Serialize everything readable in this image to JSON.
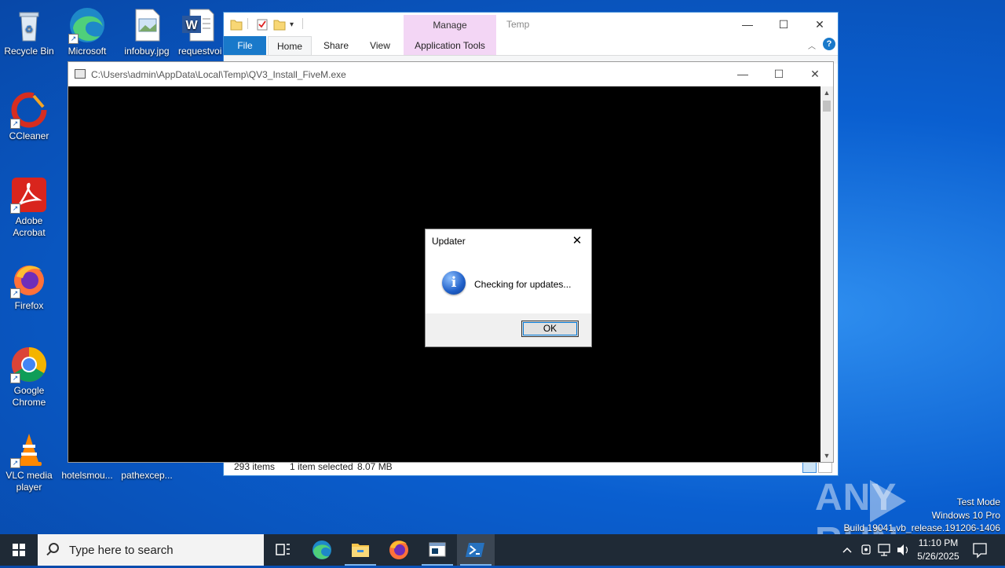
{
  "desktop": {
    "icons": [
      {
        "label": "Recycle Bin",
        "icon": "recycle-bin-icon"
      },
      {
        "label": "Microsoft",
        "icon": "edge-icon"
      },
      {
        "label": "infobuy.jpg",
        "icon": "image-file-icon"
      },
      {
        "label": "requestvoi",
        "icon": "word-doc-icon"
      },
      {
        "label": "CCleaner",
        "icon": "ccleaner-icon"
      },
      {
        "label": "Adobe Acrobat",
        "icon": "acrobat-icon"
      },
      {
        "label": "Firefox",
        "icon": "firefox-icon"
      },
      {
        "label": "Google Chrome",
        "icon": "chrome-icon"
      },
      {
        "label": "VLC media player",
        "icon": "vlc-icon"
      },
      {
        "label": "hotelsmou...",
        "icon": "file-icon"
      },
      {
        "label": "pathexcep...",
        "icon": "file-icon"
      }
    ]
  },
  "explorer": {
    "title": "Temp",
    "manage_label": "Manage",
    "tabs": [
      "File",
      "Home",
      "Share",
      "View",
      "Application Tools"
    ],
    "status": {
      "items": "293 items",
      "selected": "1 item selected",
      "size": "8.07 MB"
    }
  },
  "console": {
    "title": "C:\\Users\\admin\\AppData\\Local\\Temp\\QV3_Install_FiveM.exe"
  },
  "dialog": {
    "title": "Updater",
    "message": "Checking for updates...",
    "ok_label": "OK"
  },
  "watermark": {
    "brand_left": "ANY",
    "brand_right": "RUN",
    "line1": "Test Mode",
    "line2": "Windows 10 Pro",
    "line3": "Build 19041.vb_release.191206-1406"
  },
  "taskbar": {
    "search_placeholder": "Type here to search",
    "time": "11:10 PM",
    "date": "5/26/2025"
  },
  "colors": {
    "accent": "#1979ca",
    "taskbar": "#1f2a36",
    "manage_tab": "#f3d6f5"
  }
}
